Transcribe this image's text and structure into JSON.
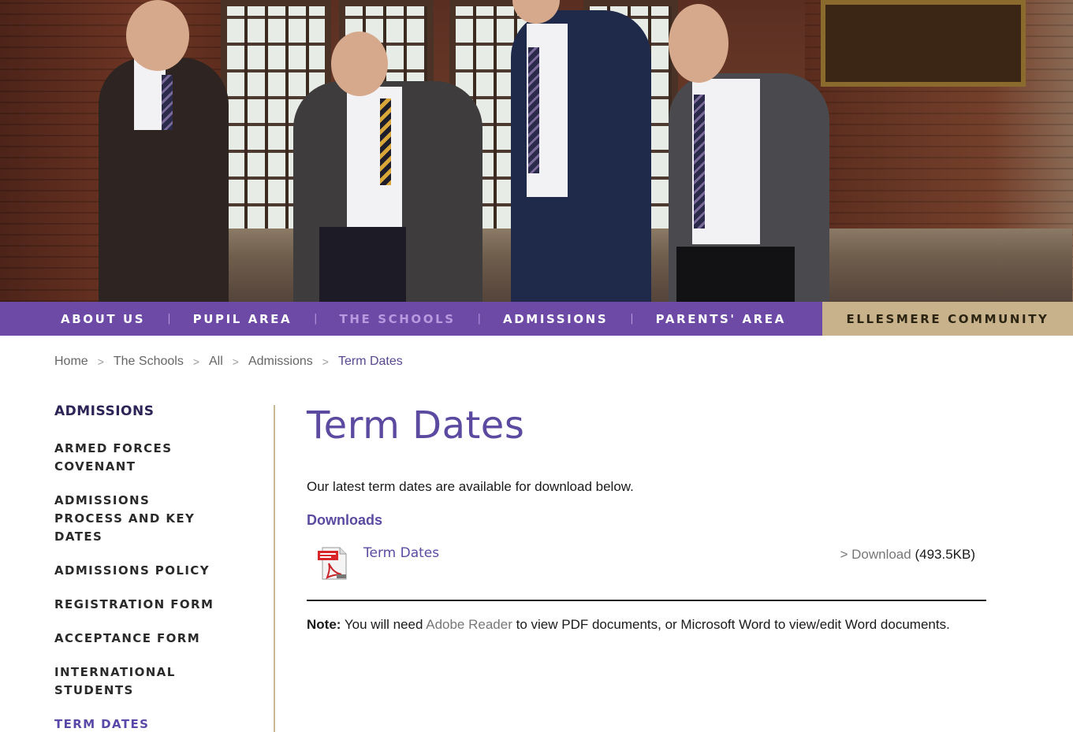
{
  "nav": {
    "items": [
      {
        "label": "ABOUT US"
      },
      {
        "label": "PUPIL AREA"
      },
      {
        "label": "THE SCHOOLS"
      },
      {
        "label": "ADMISSIONS"
      },
      {
        "label": "PARENTS' AREA"
      }
    ],
    "separator": "|",
    "community": "ELLESMERE COMMUNITY",
    "main_color": "#6c4aa6",
    "community_color": "#c8b28b"
  },
  "breadcrumb": {
    "items": [
      "Home",
      "The Schools",
      "All",
      "Admissions",
      "Term Dates"
    ],
    "separator": ">"
  },
  "sidebar": {
    "heading": "ADMISSIONS",
    "items": [
      {
        "label": "ARMED FORCES COVENANT"
      },
      {
        "label": "ADMISSIONS PROCESS AND KEY DATES"
      },
      {
        "label": "ADMISSIONS POLICY"
      },
      {
        "label": "REGISTRATION FORM"
      },
      {
        "label": "ACCEPTANCE FORM"
      },
      {
        "label": "INTERNATIONAL STUDENTS"
      },
      {
        "label": "TERM DATES"
      }
    ]
  },
  "main": {
    "title": "Term Dates",
    "intro": "Our latest term dates are available for download below.",
    "downloads_heading": "Downloads",
    "download": {
      "icon": "pdf-icon",
      "title": "Term Dates",
      "prefix": "> ",
      "link_label": "Download",
      "size": "(493.5KB)"
    },
    "note": {
      "label": "Note:",
      "text_before": "You will need",
      "link": "Adobe Reader",
      "text_after": "to view PDF documents, or Microsoft Word to view/edit Word documents."
    },
    "accent_color": "#5b4aa0"
  }
}
